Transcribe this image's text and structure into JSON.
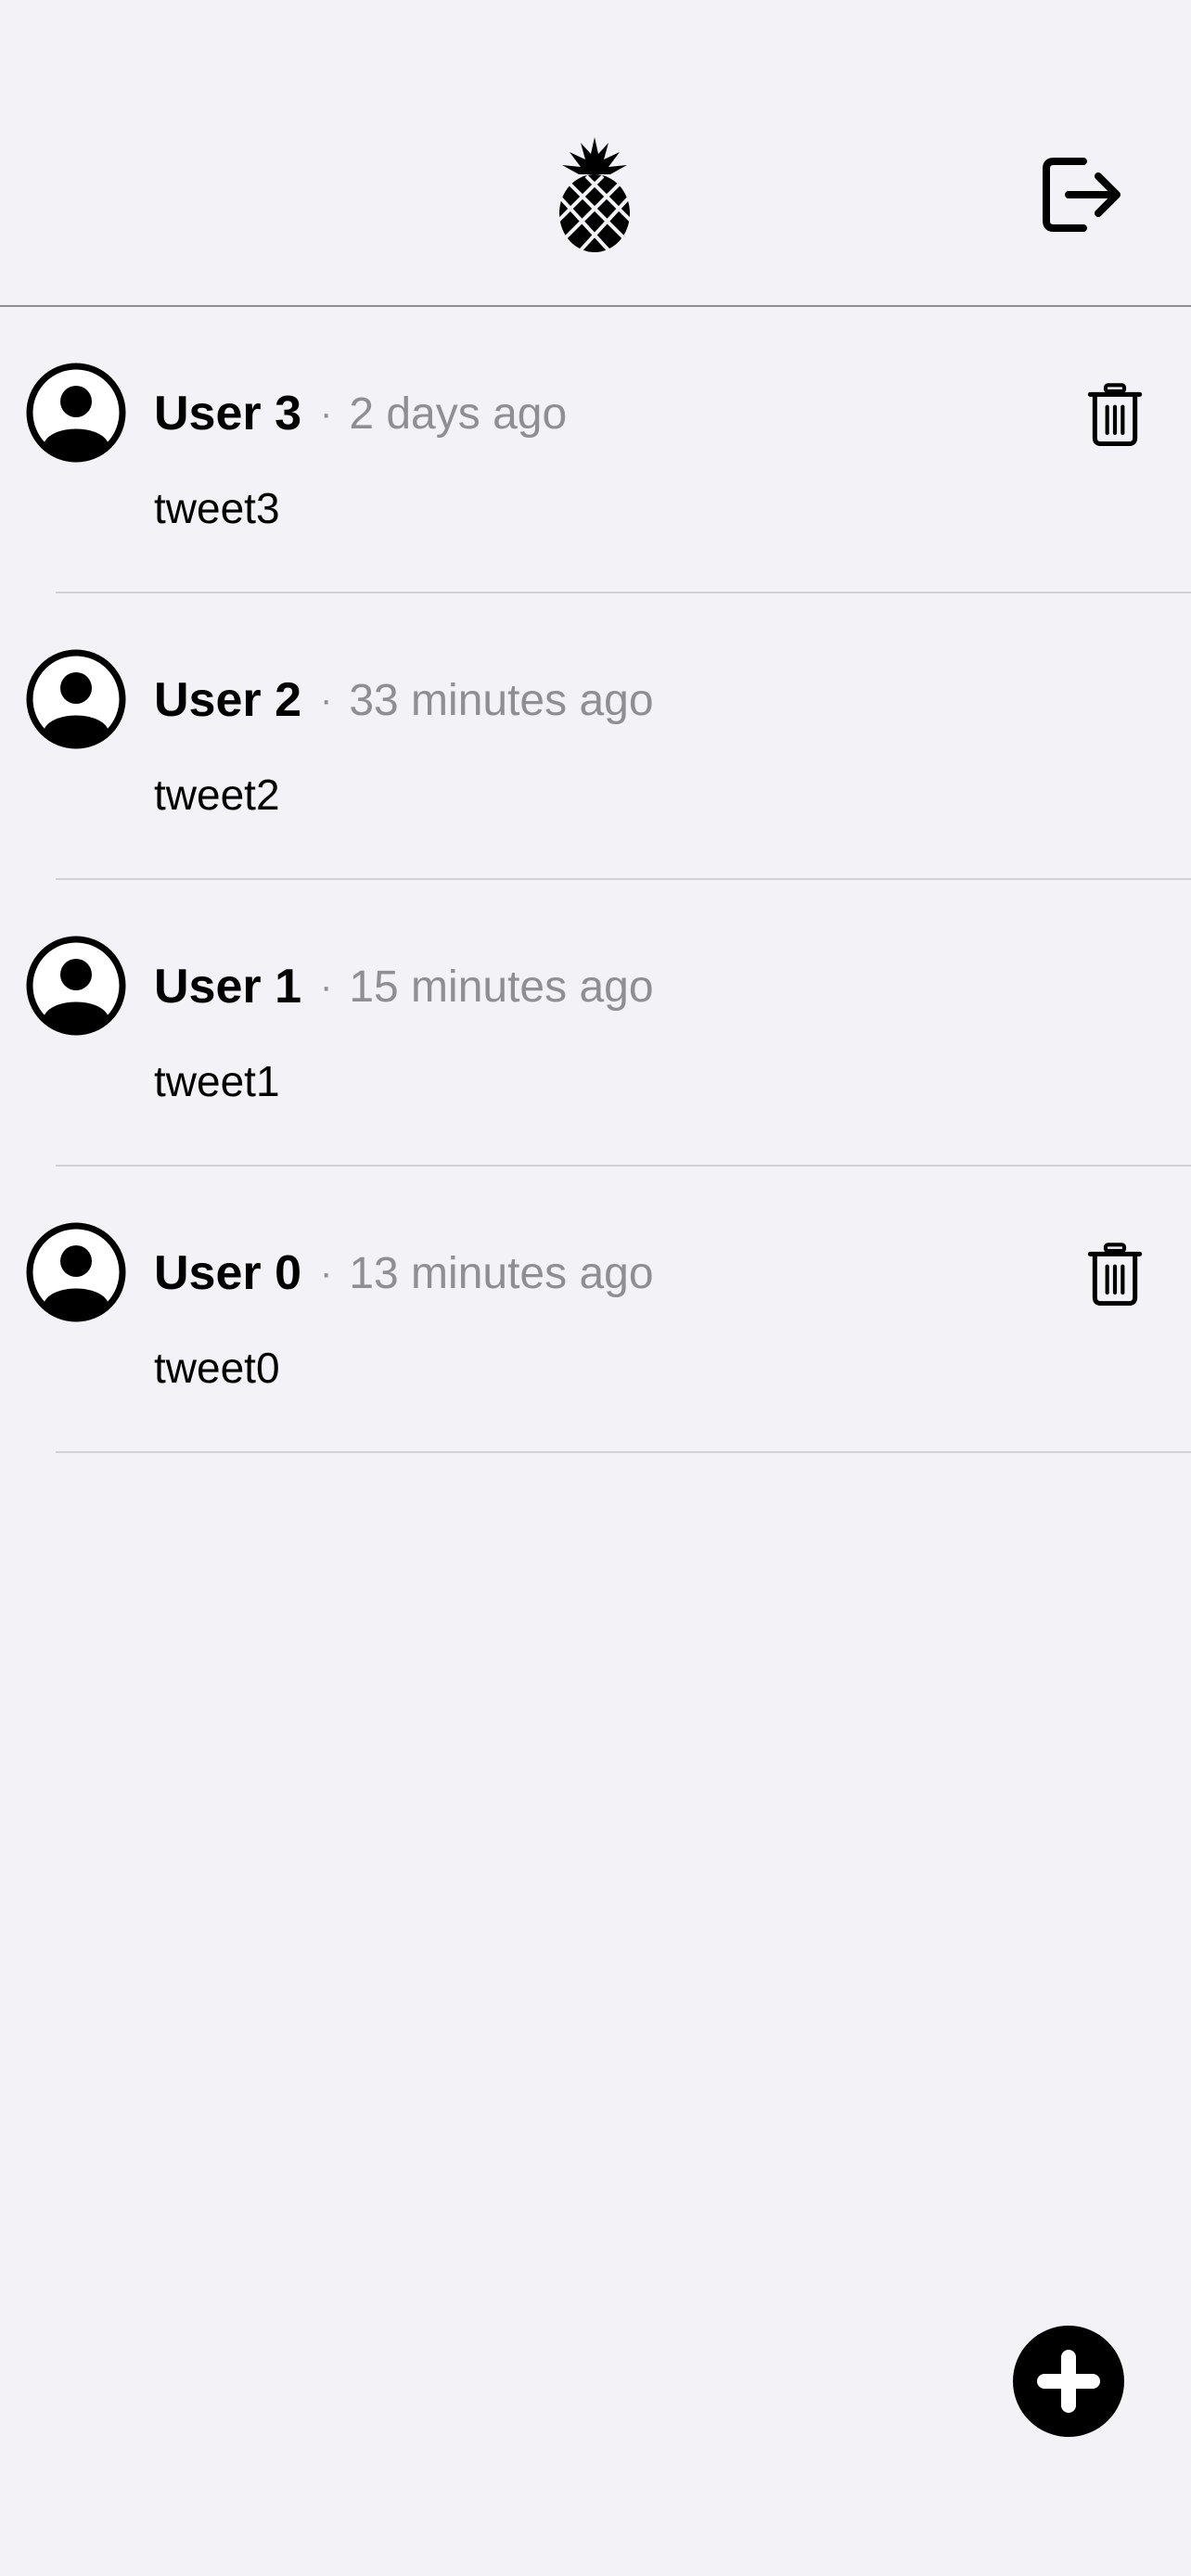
{
  "header": {
    "logo_icon": "pineapple-icon",
    "logout_icon": "logout-icon"
  },
  "feed": {
    "tweets": [
      {
        "user": "User 3",
        "separator": "·",
        "time": "2 days ago",
        "text": "tweet3",
        "deletable": true
      },
      {
        "user": "User 2",
        "separator": "·",
        "time": "33 minutes ago",
        "text": "tweet2",
        "deletable": false
      },
      {
        "user": "User 1",
        "separator": "·",
        "time": "15 minutes ago",
        "text": "tweet1",
        "deletable": false
      },
      {
        "user": "User 0",
        "separator": "·",
        "time": "13 minutes ago",
        "text": "tweet0",
        "deletable": true
      }
    ]
  },
  "fab": {
    "icon": "plus-icon"
  },
  "colors": {
    "background": "#f2f2f7",
    "secondary_text": "#8e8e93",
    "divider": "#d1d1d6",
    "primary": "#000000"
  }
}
